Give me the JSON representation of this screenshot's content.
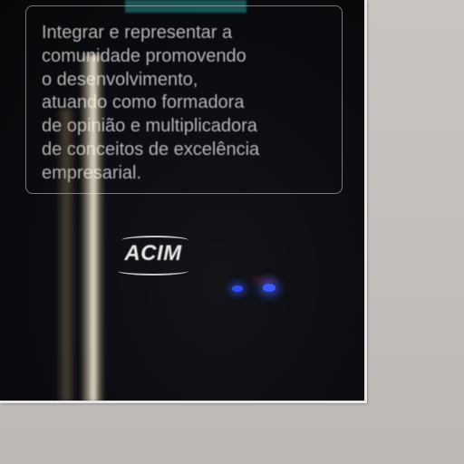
{
  "poster": {
    "mission_text": "Integrar e representar a\ncomunidade promovendo\no desenvolvimento,\natuando como formadora\nde opinião e multiplicadora\nde conceitos de excelência\nempresarial.",
    "logo_text": "ACIM",
    "colors": {
      "background": "#0b0c10",
      "text": "#e1e1e1",
      "accent_strip": "#1f6f70",
      "led": "#3a5bff"
    }
  }
}
